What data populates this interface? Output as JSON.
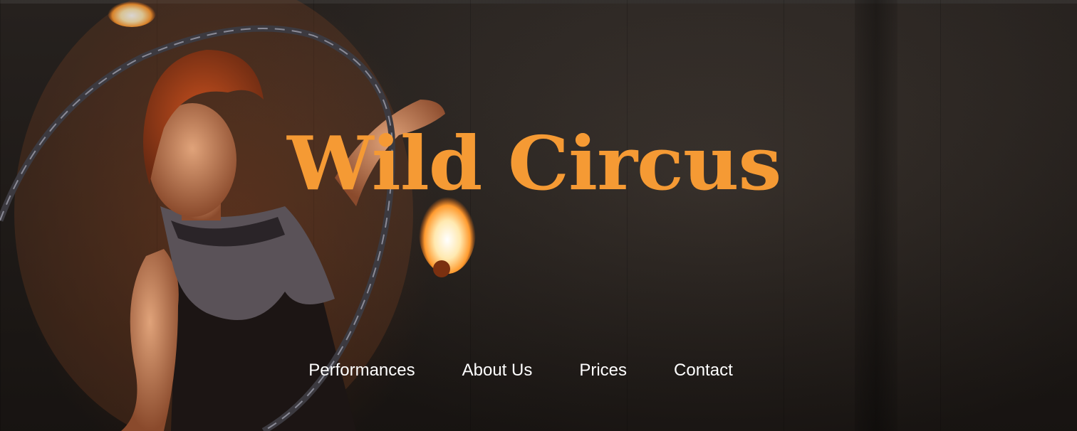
{
  "header": {
    "title": "Wild Circus"
  },
  "nav": {
    "items": [
      {
        "label": "Performances"
      },
      {
        "label": "About Us"
      },
      {
        "label": "Prices"
      },
      {
        "label": "Contact"
      }
    ]
  },
  "colors": {
    "title": "#f59a34",
    "nav_text": "#ffffff",
    "background": "#231d19"
  }
}
